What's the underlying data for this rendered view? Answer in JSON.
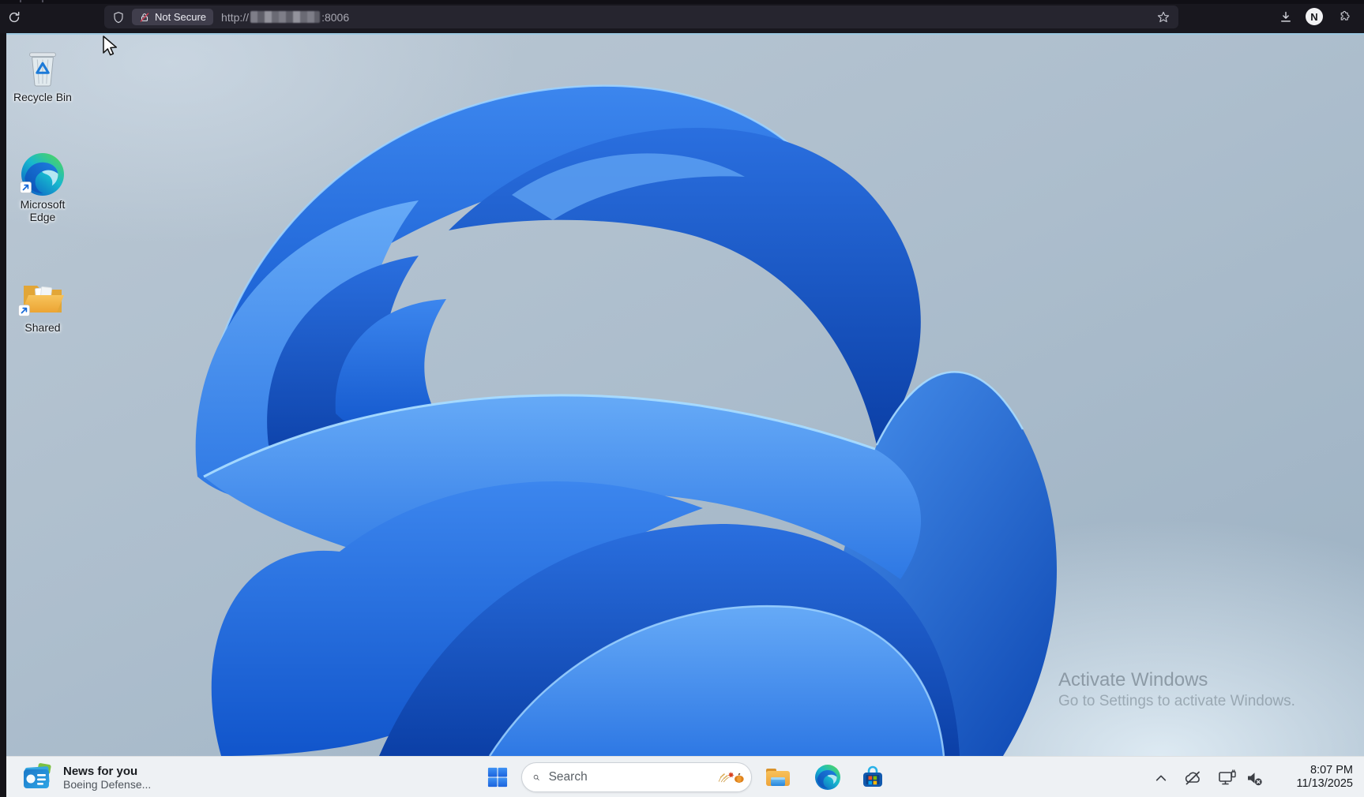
{
  "browser": {
    "security_chip": "Not Secure",
    "url_prefix": "http://",
    "url_port": ":8006",
    "account_initial": "N"
  },
  "desktop": {
    "icons": [
      {
        "label": "Recycle Bin"
      },
      {
        "label": "Microsoft Edge"
      },
      {
        "label": "Shared"
      }
    ],
    "watermark": {
      "line1": "Activate Windows",
      "line2": "Go to Settings to activate Windows."
    }
  },
  "taskbar": {
    "widget": {
      "title": "News for you",
      "subtitle": "Boeing Defense..."
    },
    "search": {
      "placeholder": "Search"
    },
    "clock": {
      "time": "8:07 PM",
      "date": "11/13/2025"
    }
  },
  "icons": {
    "toolbar": [
      "reload-icon",
      "shield-icon",
      "lock-slash-icon",
      "bookmark-star-icon",
      "download-icon",
      "account-button",
      "extensions-puzzle-icon"
    ],
    "desktop": [
      "recycle-bin-icon",
      "edge-icon",
      "shared-folder-icon",
      "shortcut-arrow-icon",
      "mouse-cursor-icon"
    ],
    "taskbar": [
      "widgets-icon",
      "start-icon",
      "search-icon",
      "autumn-decoration-icon",
      "file-explorer-icon",
      "edge-icon",
      "microsoft-store-icon",
      "tray-chevron-icon",
      "cloud-offline-icon",
      "network-display-icon",
      "volume-muted-icon"
    ]
  },
  "colors": {
    "accent_blue": "#2d7df2",
    "toolbar_bg": "#18171e",
    "taskbar_bg": "#eef1f4",
    "slash_red": "#d23b52",
    "wallpaper_blue": "#1155cb"
  }
}
